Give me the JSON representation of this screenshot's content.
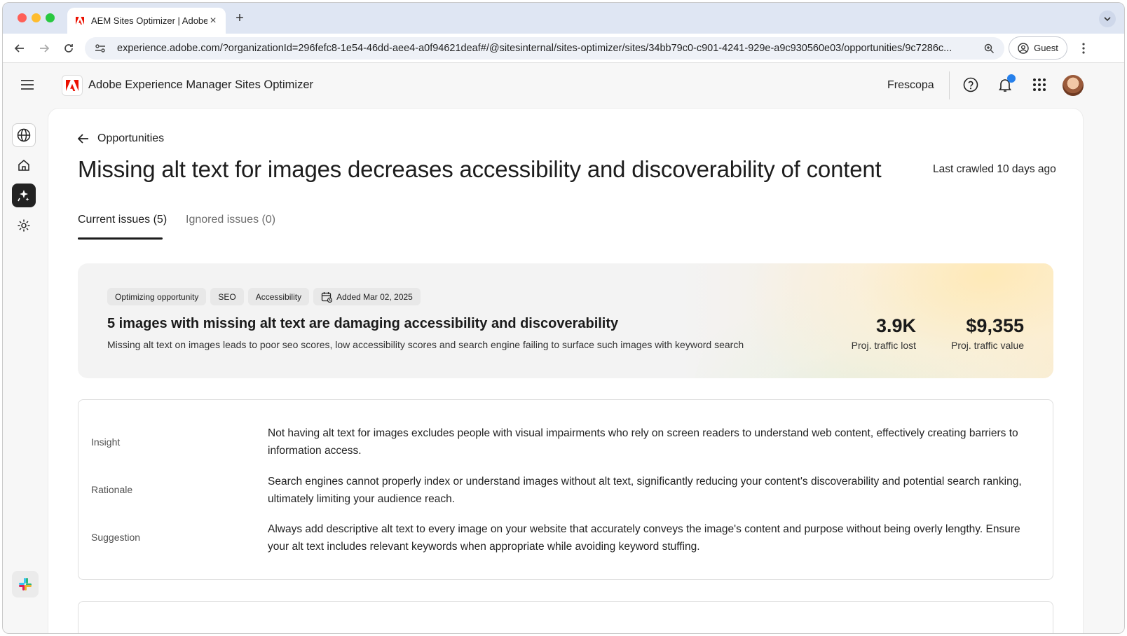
{
  "browser": {
    "tab_title": "AEM Sites Optimizer | Adobe",
    "url": "experience.adobe.com/?organizationId=296fefc8-1e54-46dd-aee4-a0f94621deaf#/@sitesinternal/sites-optimizer/sites/34bb79c0-c901-4241-929e-a9c930560e03/opportunities/9c7286c...",
    "profile_label": "Guest"
  },
  "app": {
    "title": "Adobe Experience Manager Sites Optimizer",
    "org": "Frescopa",
    "brand_color": "#eb1000",
    "notification_color": "#2680eb"
  },
  "page": {
    "back_label": "Opportunities",
    "title": "Missing alt text for images decreases accessibility and discoverability of content",
    "last_crawled": "Last crawled 10 days ago",
    "tabs": [
      {
        "label": "Current issues (5)",
        "active": true
      },
      {
        "label": "Ignored issues (0)",
        "active": false
      }
    ]
  },
  "opportunity": {
    "chips": [
      "Optimizing opportunity",
      "SEO",
      "Accessibility"
    ],
    "added": "Added Mar 02, 2025",
    "title": "5 images with missing alt text are damaging accessibility and discoverability",
    "description": "Missing alt text on images leads to poor seo scores, low accessibility scores and search engine failing to surface such images with keyword search",
    "metrics": [
      {
        "value": "3.9K",
        "label": "Proj. traffic lost"
      },
      {
        "value": "$9,355",
        "label": "Proj. traffic value"
      }
    ]
  },
  "details": [
    {
      "label": "Insight",
      "text": "Not having alt text for images excludes people with visual impairments who rely on screen readers to understand web content, effectively creating barriers to information access."
    },
    {
      "label": "Rationale",
      "text": "Search engines cannot properly index or understand images without alt text, significantly reducing your content's discoverability and potential search ranking, ultimately limiting your audience reach."
    },
    {
      "label": "Suggestion",
      "text": "Always add descriptive alt text to every image on your website that accurately conveys the image's content and purpose without being overly lengthy. Ensure your alt text includes relevant keywords when appropriate while avoiding keyword stuffing."
    }
  ]
}
